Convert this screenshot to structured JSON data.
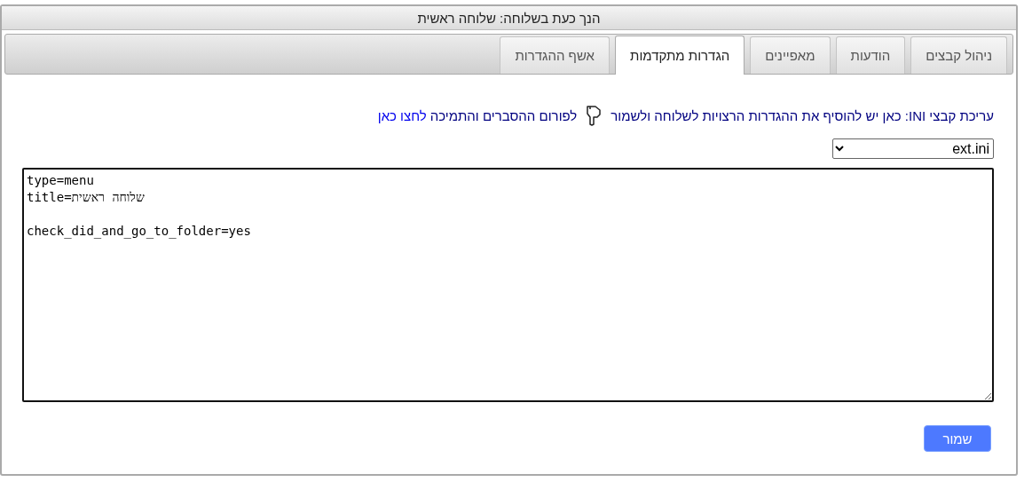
{
  "window": {
    "title": "הנך כעת בשלוחה: שלוחה ראשית"
  },
  "tabs": [
    {
      "label": "ניהול קבצים",
      "selected": false
    },
    {
      "label": "הודעות",
      "selected": false
    },
    {
      "label": "מאפיינים",
      "selected": false
    },
    {
      "label": "הגדרות מתקדמות",
      "selected": true
    },
    {
      "label": "אשף ההגדרות",
      "selected": false
    }
  ],
  "info": {
    "text": "עריכת קבצי INI: כאן יש להוסיף את ההגדרות הרצויות לשלוחה ולשמור",
    "forum_text": "לפורום ההסברים והתמיכה",
    "link": "לחצו כאן"
  },
  "file_select": {
    "value": "ext.ini"
  },
  "editor": {
    "value": "type=menu\ntitle=שלוחה ראשית\n\ncheck_did_and_go_to_folder=yes\n"
  },
  "buttons": [
    {
      "label": "שמור"
    }
  ]
}
